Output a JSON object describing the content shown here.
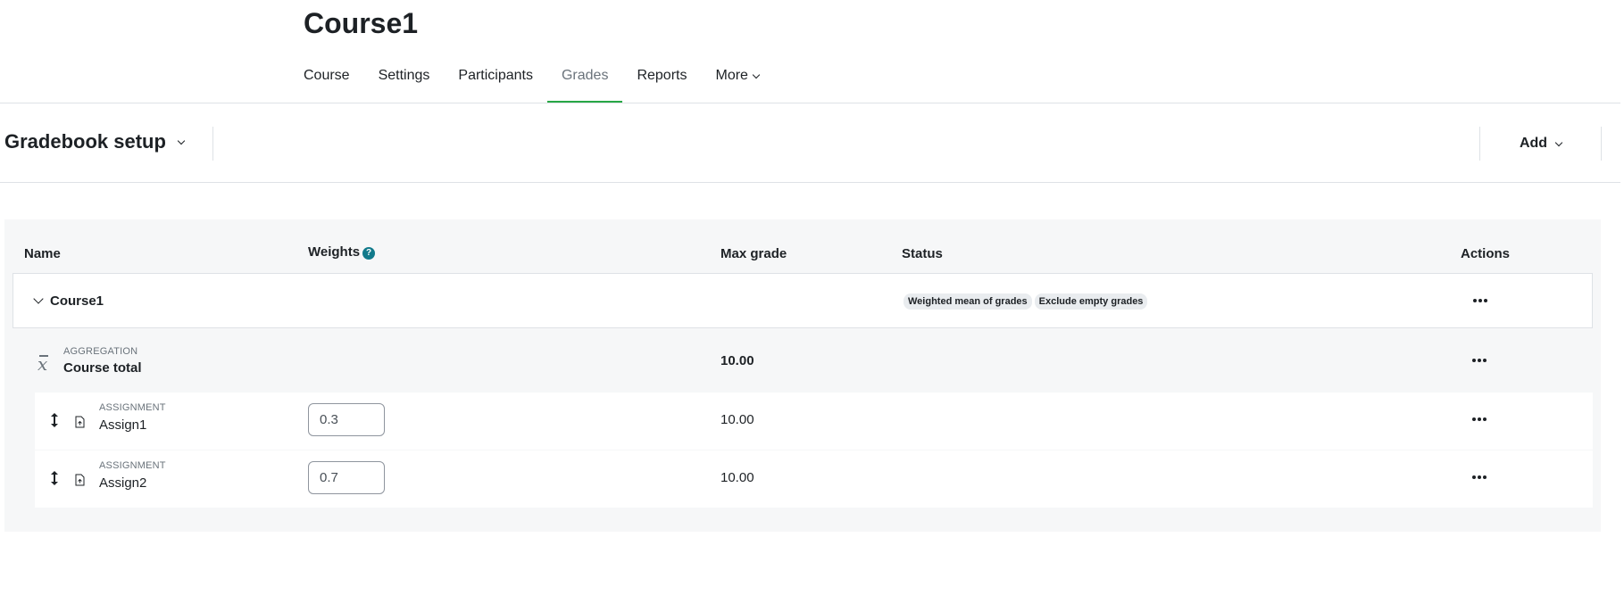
{
  "course": {
    "title": "Course1",
    "nav": [
      "Course",
      "Settings",
      "Participants",
      "Grades",
      "Reports",
      "More"
    ],
    "active_nav": "Grades"
  },
  "setup": {
    "title": "Gradebook setup",
    "add_label": "Add"
  },
  "table": {
    "headers": {
      "name": "Name",
      "weights": "Weights",
      "max_grade": "Max grade",
      "status": "Status",
      "actions": "Actions"
    },
    "help_glyph": "?",
    "category": {
      "name": "Course1",
      "badges": [
        "Weighted mean of grades",
        "Exclude empty grades"
      ]
    },
    "total": {
      "type": "AGGREGATION",
      "name": "Course total",
      "max_grade": "10.00"
    },
    "items": [
      {
        "type": "ASSIGNMENT",
        "name": "Assign1",
        "weight": "0.3",
        "max_grade": "10.00"
      },
      {
        "type": "ASSIGNMENT",
        "name": "Assign2",
        "weight": "0.7",
        "max_grade": "10.00"
      }
    ]
  },
  "colors": {
    "accent_underline": "#28a745",
    "help_icon": "#117a8b",
    "panel_bg": "#f6f7f8"
  }
}
